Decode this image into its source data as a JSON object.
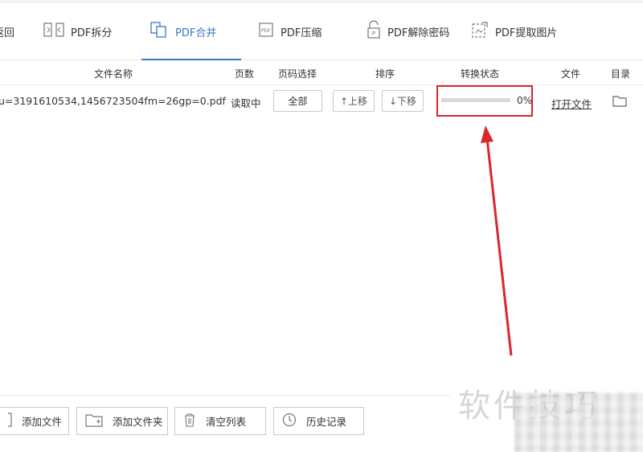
{
  "toolbar": {
    "back_label": "返回",
    "tools": [
      {
        "label": "PDF拆分"
      },
      {
        "label": "PDF合并"
      },
      {
        "label": "PDF压缩"
      },
      {
        "label": "PDF解除密码"
      },
      {
        "label": "PDF提取图片"
      }
    ],
    "active_tool": "PDF合并",
    "accent_color": "#3b78c4"
  },
  "table": {
    "columns": [
      "文件名称",
      "页数",
      "页码选择",
      "排序",
      "转换状态",
      "文件",
      "目录"
    ],
    "rows": [
      {
        "filename": "u=3191610534,1456723504fm=26gp=0.pdf",
        "pages": "读取中",
        "page_select": "全部",
        "move_up": "↑上移",
        "move_down": "↓下移",
        "progress_text": "0%",
        "progress": 0,
        "open_file": "打开文件",
        "folder_icon": "folder-icon"
      }
    ]
  },
  "bottom_buttons": [
    {
      "label": "添加文件",
      "icon": "file-icon"
    },
    {
      "label": "添加文件夹",
      "icon": "folder-add-icon"
    },
    {
      "label": "清空列表",
      "icon": "trash-icon"
    },
    {
      "label": "历史记录",
      "icon": "clock-icon"
    }
  ],
  "annotation": {
    "color": "#d9272e"
  },
  "watermark": {
    "text": "软件技巧"
  }
}
